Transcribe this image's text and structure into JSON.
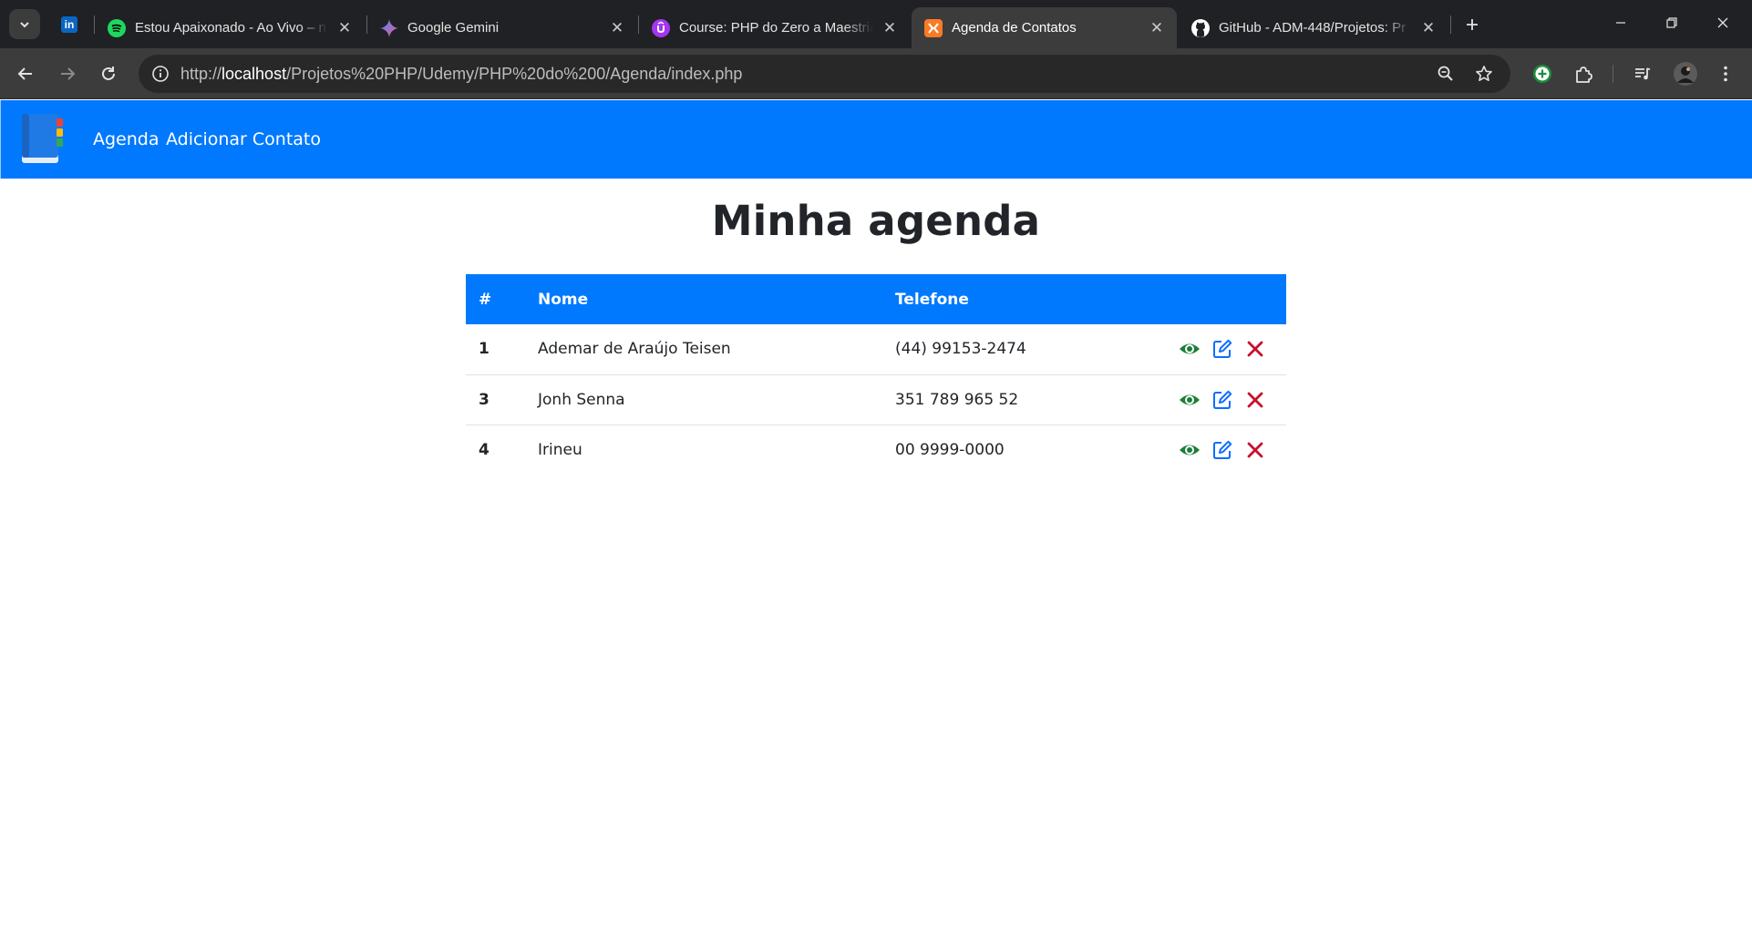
{
  "browser": {
    "tabs": [
      {
        "title": "Estou Apaixonado - Ao Vivo – n",
        "icon": "spotify-icon",
        "active": false
      },
      {
        "title": "Google Gemini",
        "icon": "gemini-icon",
        "active": false
      },
      {
        "title": "Course: PHP do Zero a Maestria",
        "icon": "udemy-icon",
        "active": false
      },
      {
        "title": "Agenda de Contatos",
        "icon": "xampp-icon",
        "active": true
      },
      {
        "title": "GitHub - ADM-448/Projetos: Pr",
        "icon": "github-icon",
        "active": false
      }
    ],
    "pinned_tab_icon": "linkedin-icon",
    "pinned_tab_text": "in",
    "address": {
      "prefix": "http://",
      "host": "localhost",
      "path": "/Projetos%20PHP/Udemy/PHP%20do%200/Agenda/index.php"
    }
  },
  "navbar": {
    "links": [
      "Agenda",
      "Adicionar Contato"
    ],
    "color": "#0079fe"
  },
  "main": {
    "title": "Minha agenda",
    "table": {
      "headers": [
        "#",
        "Nome",
        "Telefone"
      ],
      "rows": [
        {
          "id": "1",
          "name": "Ademar de Araújo Teisen",
          "phone": "(44) 99153-2474"
        },
        {
          "id": "3",
          "name": "Jonh Senna",
          "phone": "351 789 965 52"
        },
        {
          "id": "4",
          "name": "Irineu",
          "phone": "00 9999-0000"
        }
      ],
      "actions": [
        "view-icon",
        "edit-icon",
        "delete-icon"
      ],
      "action_colors": {
        "view": "#1a7f37",
        "edit": "#0d6efd",
        "delete": "#c8102e"
      }
    }
  }
}
